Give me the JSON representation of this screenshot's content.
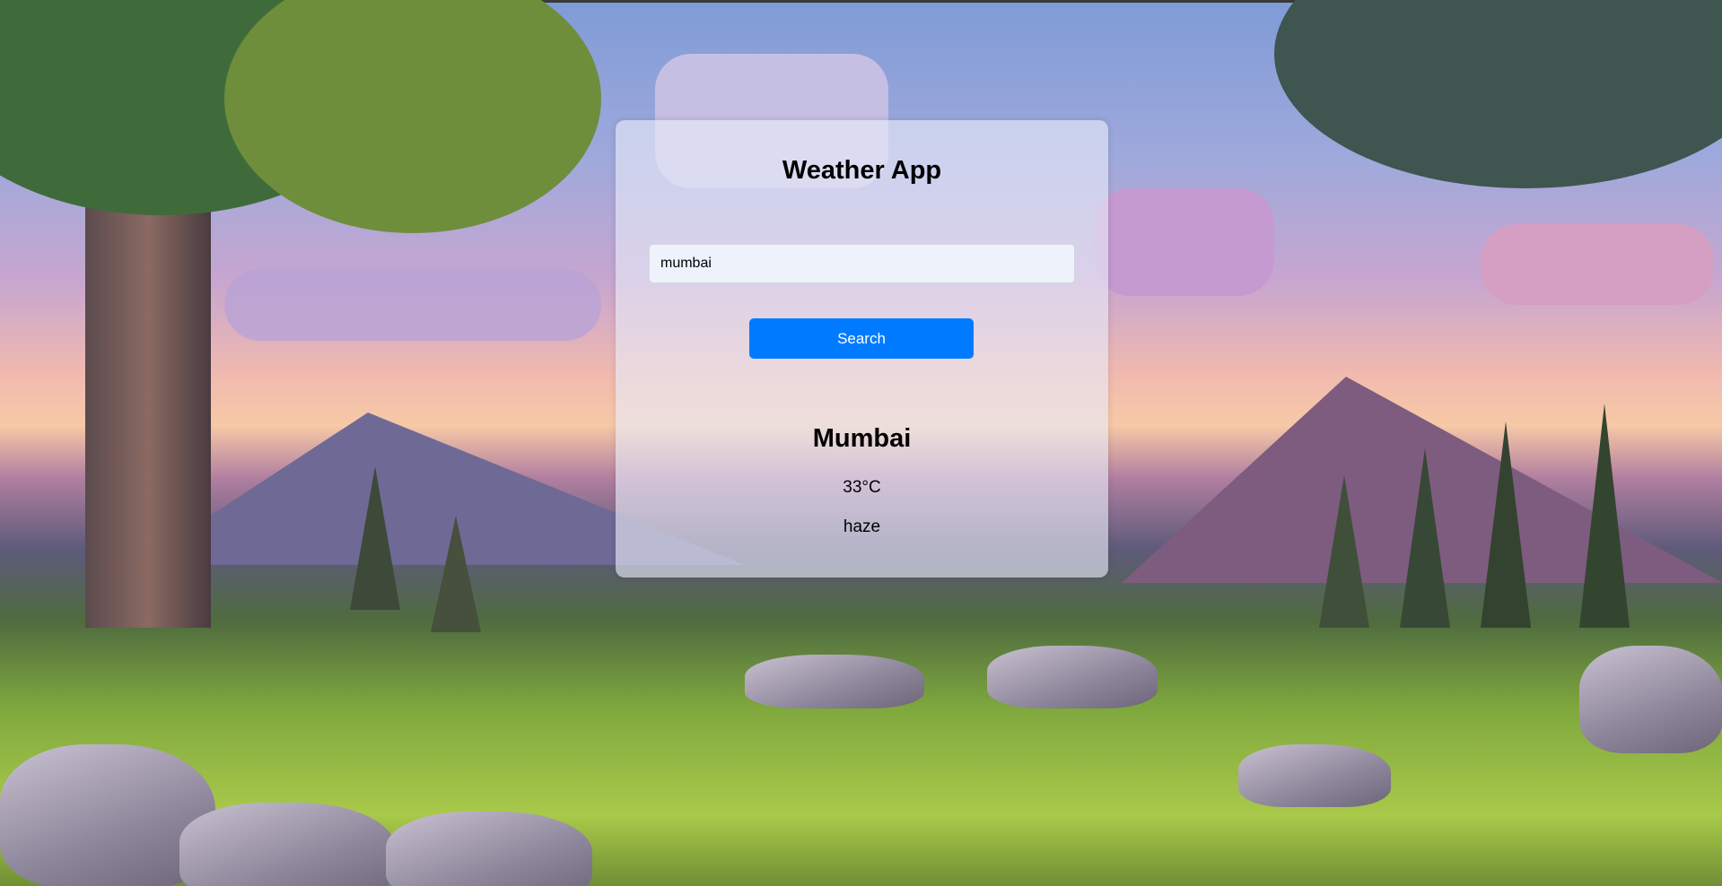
{
  "app": {
    "title": "Weather App"
  },
  "search": {
    "value": "mumbai",
    "button_label": "Search"
  },
  "result": {
    "city": "Mumbai",
    "temperature": "33°C",
    "description": "haze"
  }
}
